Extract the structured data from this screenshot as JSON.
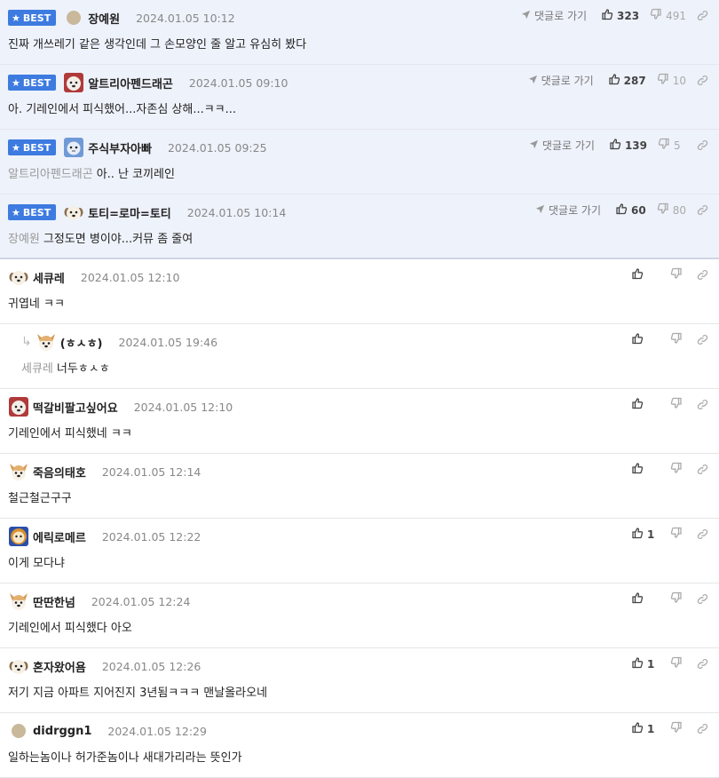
{
  "labels": {
    "best": "BEST",
    "goto_reply": "댓글로 가기"
  },
  "colors": {
    "best_bg": "#eef2fb",
    "badge": "#3d7be0"
  },
  "best_comments": [
    {
      "nick": "장예원",
      "date": "2024.01.05 10:12",
      "ref": "",
      "text": "진짜 개쓰레기 같은 생각인데 그 손모양인 줄 알고 유심히 봤다",
      "up": "323",
      "down": "491",
      "avatar": "beige-dot"
    },
    {
      "nick": "알트리아펜드래곤",
      "date": "2024.01.05 09:10",
      "ref": "",
      "text": "아. 기레인에서 피식했어...자존심 상해...ㅋㅋ...",
      "up": "287",
      "down": "10",
      "avatar": "dog-red"
    },
    {
      "nick": "주식부자아빠",
      "date": "2024.01.05 09:25",
      "ref": "알트리아펜드래곤",
      "text": "아.. 난 코끼레인",
      "up": "139",
      "down": "5",
      "avatar": "blue-cat"
    },
    {
      "nick": "토티=로마=토티",
      "date": "2024.01.05 10:14",
      "ref": "장예원",
      "text": "그정도면 병이야...커뮤 좀 줄여",
      "up": "60",
      "down": "80",
      "avatar": "puppy"
    }
  ],
  "comments": [
    {
      "nick": "세큐레",
      "date": "2024.01.05 12:10",
      "ref": "",
      "text": "귀엽네 ㅋㅋ",
      "up": "",
      "reply": false,
      "avatar": "puppy"
    },
    {
      "nick": "(ㅎㅅㅎ)",
      "date": "2024.01.05 19:46",
      "ref": "세큐레",
      "text": "너두ㅎㅅㅎ",
      "up": "",
      "reply": true,
      "avatar": "corgi"
    },
    {
      "nick": "떡갈비팔고싶어요",
      "date": "2024.01.05 12:10",
      "ref": "",
      "text": "기레인에서 피식했네 ㅋㅋ",
      "up": "",
      "reply": false,
      "avatar": "dog-red"
    },
    {
      "nick": "죽음의태호",
      "date": "2024.01.05 12:14",
      "ref": "",
      "text": "철근철근구구",
      "up": "",
      "reply": false,
      "avatar": "corgi"
    },
    {
      "nick": "에릭로메르",
      "date": "2024.01.05 12:22",
      "ref": "",
      "text": "이게 모다냐",
      "up": "1",
      "reply": false,
      "avatar": "lion-blue"
    },
    {
      "nick": "딴딴한넘",
      "date": "2024.01.05 12:24",
      "ref": "",
      "text": "기레인에서 피식했다 아오",
      "up": "",
      "reply": false,
      "avatar": "corgi"
    },
    {
      "nick": "혼자왔어욤",
      "date": "2024.01.05 12:26",
      "ref": "",
      "text": "저기 지금 아파트 지어진지 3년됨ㅋㅋㅋ 맨날올라오네",
      "up": "1",
      "reply": false,
      "avatar": "puppy"
    },
    {
      "nick": "didrggn1",
      "date": "2024.01.05 12:29",
      "ref": "",
      "text": "일하는놈이나 허가준놈이나 새대가리라는 뜻인가",
      "up": "1",
      "reply": false,
      "avatar": "beige-dot"
    }
  ]
}
